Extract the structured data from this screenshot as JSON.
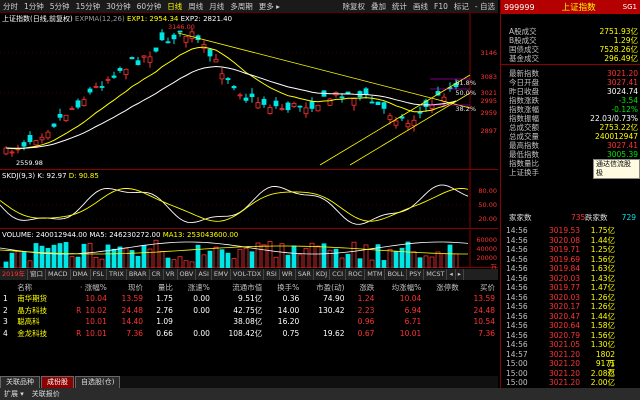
{
  "toolbar": {
    "items": [
      "分时",
      "1分钟",
      "5分钟",
      "15分钟",
      "30分钟",
      "60分钟",
      "日线",
      "周线",
      "月线",
      "多周期",
      "更多 ▸"
    ],
    "active_index": 6,
    "right_items": [
      "除复权",
      "叠加",
      "统计",
      "画线",
      "F10",
      "标记",
      "- 自选"
    ]
  },
  "main_chart": {
    "title": "上证指数(日线,前复权)",
    "indicator": "EXPMA(12,26)",
    "exp1_label": "EXP1: 2954.34",
    "exp2_label": "EXP2: 2821.40",
    "price_labels": [
      "3146",
      "3083",
      "3021",
      "2995",
      "2959",
      "2897"
    ],
    "pct_labels": [
      "61.8%",
      "50.0%",
      "38.2%"
    ],
    "high_mark": "3146.00",
    "low_mark": "2559.98"
  },
  "kdj_panel": {
    "title": "SKDJ(9,3)",
    "k_label": "K: 92.97",
    "d_label": "D: 90.85",
    "levels": [
      "80.00",
      "50.00",
      "20.00"
    ]
  },
  "vol_panel": {
    "title": "VOLUME: 240012944.00",
    "ma5_label": "MA5: 246230272.00",
    "ma13_label": "MA13: 253043600.00",
    "levels": [
      "60000",
      "40000",
      "20000",
      "万"
    ]
  },
  "indicator_tabs": [
    "2019年",
    "窗口",
    "MACD",
    "DMA",
    "FSL",
    "TRIX",
    "BRAR",
    "CR",
    "VR",
    "OBV",
    "ASI",
    "EMV",
    "VOL-TDX",
    "RSI",
    "WR",
    "SAR",
    "KDJ",
    "CCI",
    "ROC",
    "MTM",
    "BOLL",
    "PSY",
    "MCST",
    "◂",
    "▸"
  ],
  "stock_table": {
    "headers": [
      "",
      "名称",
      "· 涨幅%",
      "现价",
      "量比",
      "涨速%",
      "流通市值",
      "换手%",
      "市盈(动)",
      "涨跌",
      "均涨幅%",
      "涨停数",
      "买价"
    ],
    "rows": [
      {
        "idx": "1",
        "name": "南华期货",
        "flag": "",
        "pct": "10.04",
        "price": "13.59",
        "vr": "1.75",
        "spd": "0.00",
        "cap": "9.51亿",
        "turn": "0.36",
        "pe": "74.90",
        "chg": "1.24",
        "avg": "10.04",
        "lim": "",
        "bid": "13.59"
      },
      {
        "idx": "2",
        "name": "晶方科技",
        "flag": "R",
        "pct": "10.02",
        "price": "24.48",
        "vr": "2.76",
        "spd": "0.00",
        "cap": "42.75亿",
        "turn": "14.00",
        "pe": "130.42",
        "chg": "2.23",
        "avg": "6.94",
        "lim": "",
        "bid": "24.48"
      },
      {
        "idx": "3",
        "name": "聪高科",
        "flag": "",
        "pct": "10.01",
        "price": "14.40",
        "vr": "1.09",
        "spd": "",
        "cap": "38.08亿",
        "turn": "16.20",
        "pe": "",
        "chg": "0.96",
        "avg": "6.71",
        "lim": "",
        "bid": "10.54"
      },
      {
        "idx": "4",
        "name": "金龙科技",
        "flag": "R",
        "pct": "10.01",
        "price": "7.36",
        "vr": "0.66",
        "spd": "0.00",
        "cap": "108.42亿",
        "turn": "0.75",
        "pe": "19.62",
        "chg": "0.67",
        "avg": "10.01",
        "lim": "",
        "bid": "7.36"
      }
    ]
  },
  "bottom_tabs": [
    "关联品种",
    "成份股",
    "自选股(仓)"
  ],
  "bottom_active": 1,
  "status": [
    "扩展 ▾",
    "关联报价"
  ],
  "right_panel": {
    "code": "999999",
    "name": "上证指数",
    "badge": "SG1",
    "fields": [
      {
        "k": "A股成交",
        "v": "2751.93亿",
        "c": "yel"
      },
      {
        "k": "B股成交",
        "v": "1.29亿",
        "c": "yel"
      },
      {
        "k": "国债成交",
        "v": "7528.26亿",
        "c": "yel"
      },
      {
        "k": "基金成交",
        "v": "296.49亿",
        "c": "yel"
      },
      {
        "k": "最新指数",
        "v": "3021.20",
        "c": "red"
      },
      {
        "k": "今日开盘",
        "v": "3027.41",
        "c": "red"
      },
      {
        "k": "昨日收盘",
        "v": "3024.74",
        "c": "wht"
      },
      {
        "k": "指数涨跌",
        "v": "-3.54",
        "c": "grn"
      },
      {
        "k": "指数涨幅",
        "v": "-0.12%",
        "c": "grn"
      },
      {
        "k": "指数振幅",
        "v": "22.03/0.73%",
        "c": "wht"
      },
      {
        "k": "总成交额",
        "v": "2753.22亿",
        "c": "yel"
      },
      {
        "k": "总成交量",
        "v": "240012947",
        "c": "yel"
      },
      {
        "k": "最高指数",
        "v": "3027.41",
        "c": "red"
      },
      {
        "k": "最低指数",
        "v": "3005.39",
        "c": "grn"
      },
      {
        "k": "指数量比",
        "v": "",
        "c": "wht"
      },
      {
        "k": "上证换手",
        "v": "0.69%",
        "c": "wht"
      }
    ],
    "tooltip": "通达信流股极",
    "ratio": {
      "left_label": "家家数",
      "left_val": "",
      "mid_label": "735",
      "right_label": "跌家数",
      "right_val": "729"
    },
    "ticks": [
      {
        "t": "14:56",
        "p": "3019.53",
        "v": "1.75亿",
        "f": "",
        "c": "grn"
      },
      {
        "t": "14:56",
        "p": "3020.08",
        "v": "1.44亿",
        "f": "",
        "c": "grn"
      },
      {
        "t": "14:56",
        "p": "3019.71",
        "v": "1.25亿",
        "f": "",
        "c": "grn"
      },
      {
        "t": "14:56",
        "p": "3019.69",
        "v": "1.56亿",
        "f": "",
        "c": "grn"
      },
      {
        "t": "14:56",
        "p": "3019.84",
        "v": "1.63亿",
        "f": "",
        "c": "grn"
      },
      {
        "t": "14:56",
        "p": "3020.03",
        "v": "1.43亿",
        "f": "",
        "c": "grn"
      },
      {
        "t": "14:56",
        "p": "3019.77",
        "v": "1.47亿",
        "f": "",
        "c": "grn"
      },
      {
        "t": "14:56",
        "p": "3020.03",
        "v": "1.26亿",
        "f": "",
        "c": "grn"
      },
      {
        "t": "14:56",
        "p": "3020.17",
        "v": "1.26亿",
        "f": "",
        "c": "grn"
      },
      {
        "t": "14:56",
        "p": "3020.47",
        "v": "1.44亿",
        "f": "",
        "c": "grn"
      },
      {
        "t": "14:56",
        "p": "3020.64",
        "v": "1.58亿",
        "f": "",
        "c": "grn"
      },
      {
        "t": "14:56",
        "p": "3020.79",
        "v": "1.56亿",
        "f": "",
        "c": "grn"
      },
      {
        "t": "14:56",
        "p": "3021.05",
        "v": "1.30亿",
        "f": "",
        "c": "grn"
      },
      {
        "t": "14:57",
        "p": "3021.20",
        "v": "1802万",
        "f": "",
        "c": "grn"
      },
      {
        "t": "15:00",
        "p": "3021.20",
        "v": "9171万",
        "f": "",
        "c": "grn"
      },
      {
        "t": "15:00",
        "p": "3021.20",
        "v": "2.08亿",
        "f": "",
        "c": "grn"
      },
      {
        "t": "15:00",
        "p": "3021.20",
        "v": "2.00亿",
        "f": "",
        "c": "grn"
      }
    ]
  },
  "colors": {
    "up": "#ff3232",
    "down": "#00e6e6",
    "ma_yellow": "#ffff00",
    "ma_white": "#ffffff",
    "grid": "#8b0000"
  }
}
